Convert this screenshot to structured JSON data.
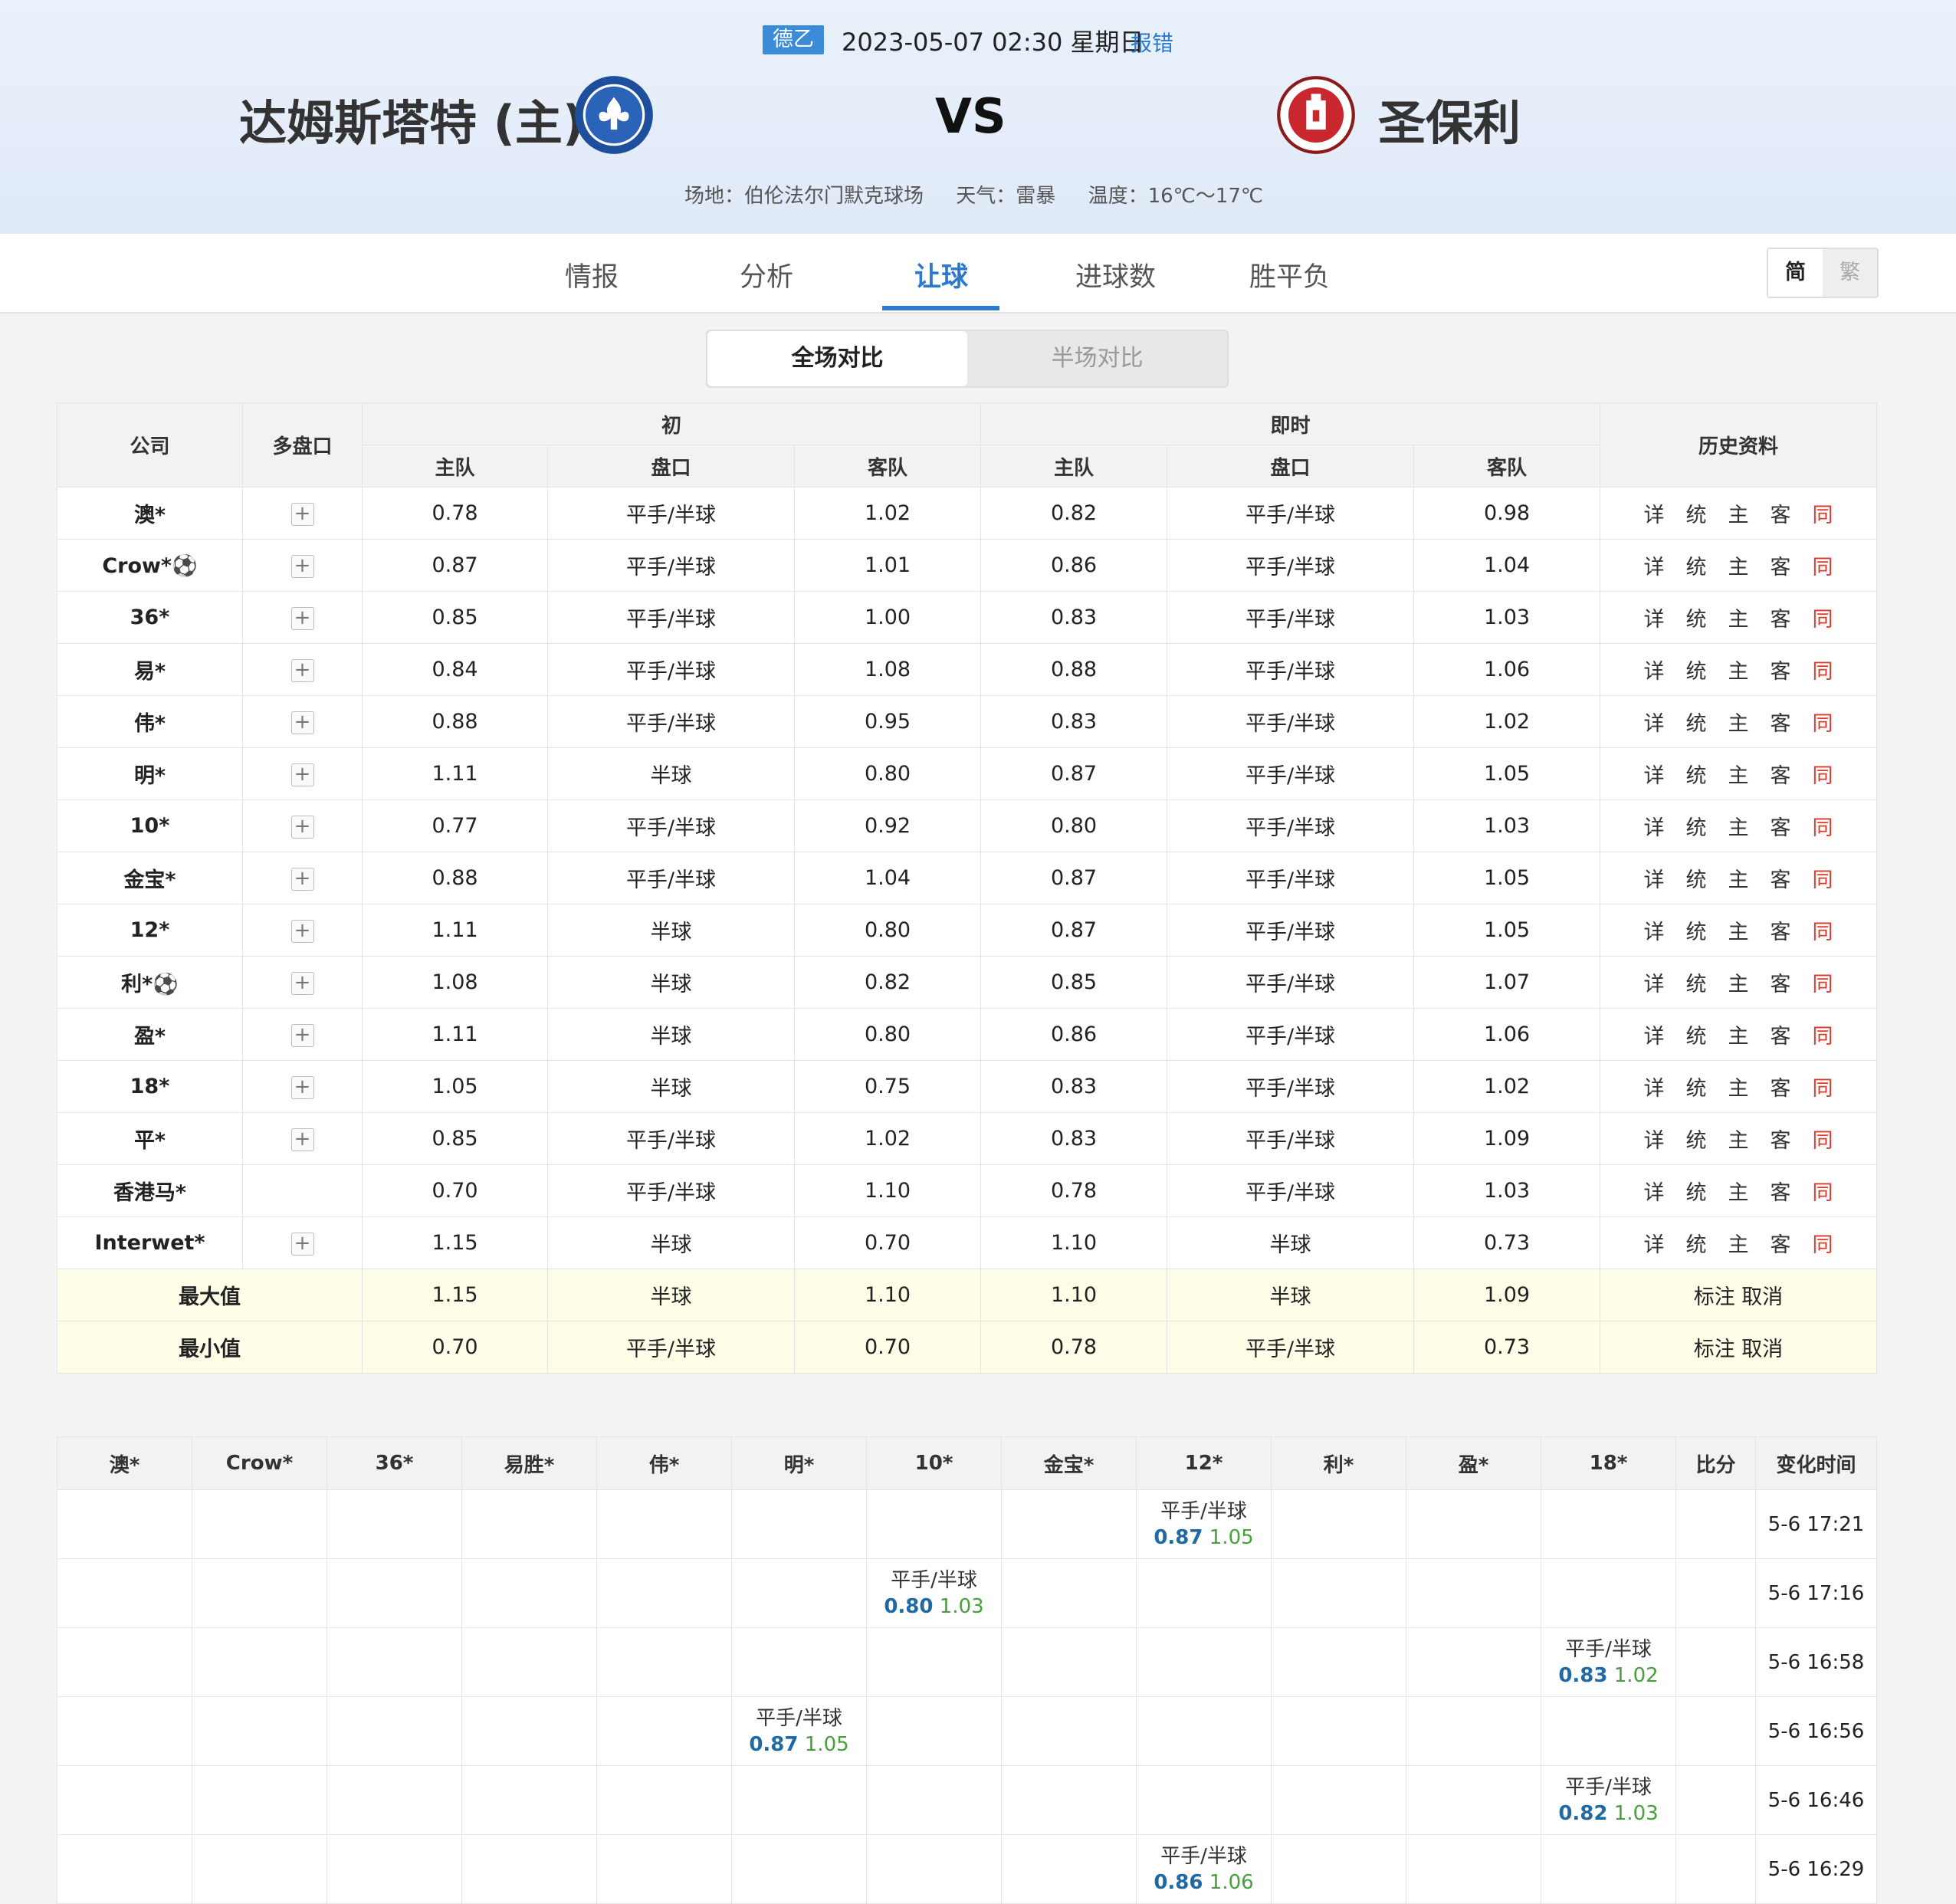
{
  "match": {
    "league": "德乙",
    "datetime": "2023-05-07 02:30 星期日",
    "report_link": "报错",
    "home_team": "达姆斯塔特 (主)",
    "away_team": "圣保利",
    "vs": "VS",
    "venue": "场地：伯伦法尔门默克球场",
    "weather": "天气：雷暴",
    "temperature": "温度：16℃～17℃"
  },
  "tabs": [
    "情报",
    "分析",
    "让球",
    "进球数",
    "胜平负"
  ],
  "active_tab": "让球",
  "lang": {
    "simplified": "简",
    "traditional": "繁"
  },
  "compare": {
    "full": "全场对比",
    "half": "半场对比"
  },
  "odds_header": {
    "company": "公司",
    "multi": "多盘口",
    "initial": "初",
    "live": "即时",
    "history": "历史资料",
    "home": "主队",
    "handicap": "盘口",
    "away": "客队"
  },
  "history_links": [
    "详",
    "统",
    "主",
    "客",
    "同"
  ],
  "odds_rows": [
    {
      "company": "澳*",
      "multi": true,
      "ih": "0.78",
      "ip": "平手/半球",
      "ia": "1.02",
      "lh": "0.82",
      "lp": "平手/半球",
      "la": "0.98"
    },
    {
      "company": "Crow*⚽",
      "multi": true,
      "ih": "0.87",
      "ip": "平手/半球",
      "ia": "1.01",
      "lh": "0.86",
      "lp": "平手/半球",
      "la": "1.04"
    },
    {
      "company": "36*",
      "multi": true,
      "ih": "0.85",
      "ip": "平手/半球",
      "ia": "1.00",
      "lh": "0.83",
      "lp": "平手/半球",
      "la": "1.03"
    },
    {
      "company": "易*",
      "multi": true,
      "ih": "0.84",
      "ip": "平手/半球",
      "ia": "1.08",
      "lh": "0.88",
      "lp": "平手/半球",
      "la": "1.06"
    },
    {
      "company": "伟*",
      "multi": true,
      "ih": "0.88",
      "ip": "平手/半球",
      "ia": "0.95",
      "lh": "0.83",
      "lp": "平手/半球",
      "la": "1.02"
    },
    {
      "company": "明*",
      "multi": true,
      "ih": "1.11",
      "ip": "半球",
      "ia": "0.80",
      "lh": "0.87",
      "lp": "平手/半球",
      "la": "1.05"
    },
    {
      "company": "10*",
      "multi": true,
      "ih": "0.77",
      "ip": "平手/半球",
      "ia": "0.92",
      "lh": "0.80",
      "lp": "平手/半球",
      "la": "1.03"
    },
    {
      "company": "金宝*",
      "multi": true,
      "ih": "0.88",
      "ip": "平手/半球",
      "ia": "1.04",
      "lh": "0.87",
      "lp": "平手/半球",
      "la": "1.05"
    },
    {
      "company": "12*",
      "multi": true,
      "ih": "1.11",
      "ip": "半球",
      "ia": "0.80",
      "lh": "0.87",
      "lp": "平手/半球",
      "la": "1.05"
    },
    {
      "company": "利*⚽",
      "multi": true,
      "ih": "1.08",
      "ip": "半球",
      "ia": "0.82",
      "lh": "0.85",
      "lp": "平手/半球",
      "la": "1.07"
    },
    {
      "company": "盈*",
      "multi": true,
      "ih": "1.11",
      "ip": "半球",
      "ia": "0.80",
      "lh": "0.86",
      "lp": "平手/半球",
      "la": "1.06"
    },
    {
      "company": "18*",
      "multi": true,
      "ih": "1.05",
      "ip": "半球",
      "ia": "0.75",
      "lh": "0.83",
      "lp": "平手/半球",
      "la": "1.02"
    },
    {
      "company": "平*",
      "multi": true,
      "ih": "0.85",
      "ip": "平手/半球",
      "ia": "1.02",
      "lh": "0.83",
      "lp": "平手/半球",
      "la": "1.09"
    },
    {
      "company": "香港马*",
      "multi": false,
      "ih": "0.70",
      "ip": "平手/半球",
      "ia": "1.10",
      "lh": "0.78",
      "lp": "平手/半球",
      "la": "1.03"
    },
    {
      "company": "Interwet*",
      "multi": true,
      "ih": "1.15",
      "ip": "半球",
      "ia": "0.70",
      "lh": "1.10",
      "lp": "半球",
      "la": "0.73"
    }
  ],
  "summary_rows": [
    {
      "label": "最大值",
      "ih": "1.15",
      "ip": "半球",
      "ia": "1.10",
      "lh": "1.10",
      "lp": "半球",
      "la": "1.09",
      "action": "标注 取消"
    },
    {
      "label": "最小值",
      "ih": "0.70",
      "ip": "平手/半球",
      "ia": "0.70",
      "lh": "0.78",
      "lp": "平手/半球",
      "la": "0.73",
      "action": "标注 取消"
    }
  ],
  "change_header": [
    "澳*",
    "Crow*",
    "36*",
    "易胜*",
    "伟*",
    "明*",
    "10*",
    "金宝*",
    "12*",
    "利*",
    "盈*",
    "18*",
    "比分",
    "变化时间"
  ],
  "change_rows": [
    {
      "col": 8,
      "handicap": "平手/半球",
      "home": "0.87",
      "away": "1.05",
      "time": "5-6 17:21"
    },
    {
      "col": 6,
      "handicap": "平手/半球",
      "home": "0.80",
      "away": "1.03",
      "time": "5-6 17:16"
    },
    {
      "col": 11,
      "handicap": "平手/半球",
      "home": "0.83",
      "away": "1.02",
      "time": "5-6 16:58"
    },
    {
      "col": 5,
      "handicap": "平手/半球",
      "home": "0.87",
      "away": "1.05",
      "time": "5-6 16:56"
    },
    {
      "col": 11,
      "handicap": "平手/半球",
      "home": "0.82",
      "away": "1.03",
      "time": "5-6 16:46"
    },
    {
      "col": 8,
      "handicap": "平手/半球",
      "home": "0.86",
      "away": "1.06",
      "time": "5-6 16:29"
    }
  ],
  "colors": {
    "accent": "#2b7ad0",
    "same_link": "#e0382b",
    "home_odds": "#1f6aa5",
    "away_odds": "#47a03c",
    "summary_bg": "#fdfde8"
  }
}
